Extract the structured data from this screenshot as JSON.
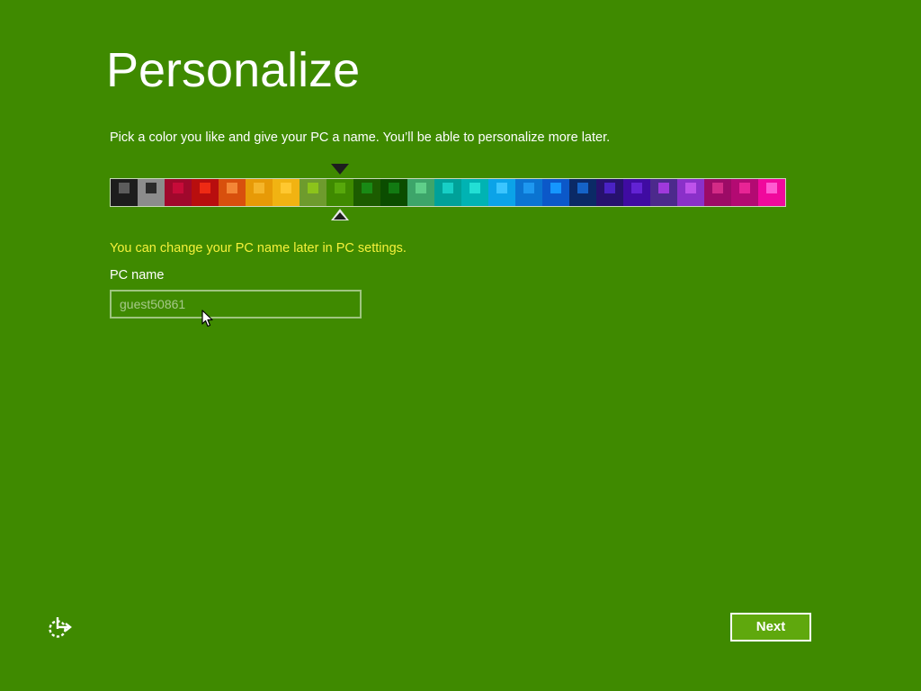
{
  "page": {
    "title": "Personalize",
    "instruction": "Pick a color you like and give your PC a name. You’ll be able to personalize more later.",
    "background_color": "#3f8a00"
  },
  "palette": {
    "selected_index": 8,
    "swatches": [
      {
        "base": "#1d1d1d",
        "accent": "#5c5c5c"
      },
      {
        "base": "#8c8c8c",
        "accent": "#2a2a2a"
      },
      {
        "base": "#a0082c",
        "accent": "#c70b39"
      },
      {
        "base": "#b80e0e",
        "accent": "#ee2a14"
      },
      {
        "base": "#d8500d",
        "accent": "#f48636"
      },
      {
        "base": "#e79a07",
        "accent": "#f5b52a"
      },
      {
        "base": "#f1b312",
        "accent": "#ffc830"
      },
      {
        "base": "#6e9b2d",
        "accent": "#8cc31b"
      },
      {
        "base": "#3f8a00",
        "accent": "#57a80b"
      },
      {
        "base": "#1c5c00",
        "accent": "#198a15"
      },
      {
        "base": "#0b4d00",
        "accent": "#127a12"
      },
      {
        "base": "#3da56a",
        "accent": "#5fcf8a"
      },
      {
        "base": "#00a199",
        "accent": "#17cfc6"
      },
      {
        "base": "#00b3b3",
        "accent": "#22dfd5"
      },
      {
        "base": "#0ba3e8",
        "accent": "#3bc5ff"
      },
      {
        "base": "#0b74d1",
        "accent": "#1e98f0"
      },
      {
        "base": "#0b58c9",
        "accent": "#1596ff"
      },
      {
        "base": "#0b2a66",
        "accent": "#1563c7"
      },
      {
        "base": "#27126e",
        "accent": "#4a22c4"
      },
      {
        "base": "#3f0ba2",
        "accent": "#6222d4"
      },
      {
        "base": "#4c2a8c",
        "accent": "#9f39dc"
      },
      {
        "base": "#8a30c9",
        "accent": "#be52eb"
      },
      {
        "base": "#9c0b66",
        "accent": "#d32b86"
      },
      {
        "base": "#b30a72",
        "accent": "#e82495"
      },
      {
        "base": "#f0099c",
        "accent": "#ff5bd1"
      }
    ]
  },
  "hint": {
    "text": "You can change your PC name later in PC settings.",
    "color": "#f5f13a"
  },
  "pc_name": {
    "label": "PC name",
    "value": "",
    "placeholder": "guest50861"
  },
  "footer": {
    "ease_icon": "ease-of-access-icon",
    "next_label": "Next"
  }
}
